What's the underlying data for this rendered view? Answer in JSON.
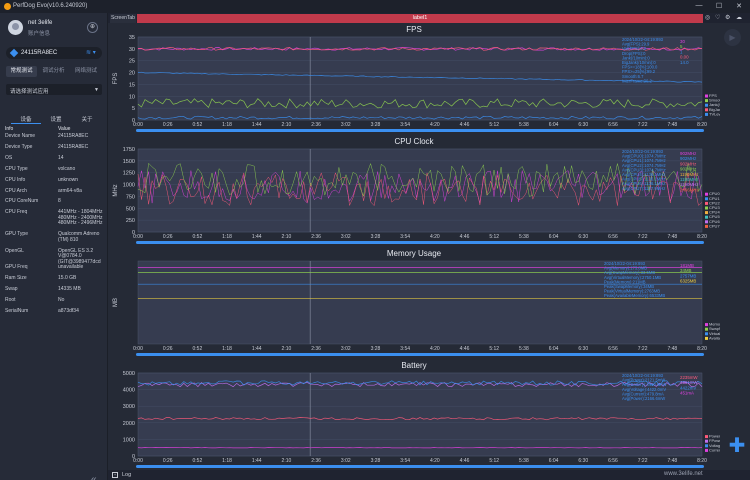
{
  "app": {
    "title": "PerfDog Evo(v10.6.240920)"
  },
  "window": {
    "minimize": "—",
    "maximize": "☐",
    "close": "✕"
  },
  "user": {
    "name": "net 3elife",
    "status": "账户信息"
  },
  "device": {
    "name": "24115RA8EC"
  },
  "mode_tabs": [
    "常规测试",
    "调试分析",
    "网络测试"
  ],
  "app_select": {
    "placeholder": "请选择测试应用"
  },
  "sub_tabs": [
    "设备",
    "设置",
    "关于"
  ],
  "info": {
    "header": {
      "k": "Info",
      "v": "Value"
    },
    "rows": [
      {
        "k": "Device Name",
        "v": "24115RA8EC"
      },
      {
        "k": "Device Type",
        "v": "24115RA8EC"
      },
      {
        "k": "OS",
        "v": "14"
      },
      {
        "k": "CPU Type",
        "v": "volcano"
      },
      {
        "k": "CPU Info",
        "v": "unknown"
      },
      {
        "k": "CPU Arch",
        "v": "arm64-v8a"
      },
      {
        "k": "CPU CoreNum",
        "v": "8"
      },
      {
        "k": "CPU Freq",
        "v": "441MHz - 1804MHz\n480MHz - 2400MHz\n480MHz - 2496MHz"
      },
      {
        "k": "GPU Type",
        "v": "Qualcomm Adreno (TM) 810"
      },
      {
        "k": "OpenGL",
        "v": "OpenGL ES 3.2 V@0784.0 (GIT@3989477dcd"
      },
      {
        "k": "GPU Freq",
        "v": "unavailable"
      },
      {
        "k": "Ram Size",
        "v": "15.0 GB"
      },
      {
        "k": "Swap",
        "v": "14335 MB"
      },
      {
        "k": "Root",
        "v": "No"
      },
      {
        "k": "SerialNum",
        "v": "a873df34"
      }
    ]
  },
  "tabs": {
    "first": "ScreenTab",
    "active": "label1"
  },
  "bottom": {
    "log": "Log",
    "watermark": "www.3elife.net"
  },
  "colors": {
    "accent": "#3b8ff0",
    "panel": "#363c50",
    "active_tab": "#c13a4b"
  },
  "chart_data": [
    {
      "type": "line",
      "title": "FPS",
      "ylabel": "FPS",
      "ylim": [
        0,
        35
      ],
      "yticks": [
        0,
        5,
        10,
        15,
        20,
        25,
        30,
        35
      ],
      "xticks": [
        "0:00",
        "0:26",
        "0:52",
        "1:18",
        "1:44",
        "2:10",
        "2:36",
        "3:02",
        "3:28",
        "3:54",
        "4:20",
        "4:46",
        "5:12",
        "5:38",
        "6:04",
        "6:30",
        "6:56",
        "7:22",
        "7:48",
        "8:20"
      ],
      "series": [
        {
          "name": "FPS",
          "color": "#e040e0",
          "approx": 30
        },
        {
          "name": "Smooth",
          "color": "#8fd14f",
          "approx": 5
        },
        {
          "name": "Jank",
          "color": "#3b8ff0",
          "approx": 1
        },
        {
          "name": "InterFrame",
          "color": "#ff5a7a",
          "approx": 30
        },
        {
          "name": "TVLevelFPS",
          "color": "#3b8ff0",
          "approx": 17
        }
      ],
      "legend": [
        "FPS",
        "Smooth",
        "Jank(/10min)",
        "BigJank(/10min)",
        "TVLevelFPS"
      ],
      "legend_values": [
        "30",
        "5",
        "1",
        "0.00",
        "14.0"
      ],
      "legend_colors": [
        "#e040e0",
        "#8fd14f",
        "#3b8ff0",
        "#ff5a7a",
        "#3b8ff0"
      ],
      "summary": [
        "2024/10/22-04:19:893",
        "Avg(FPS):29.9",
        "Var(FPS):0.2",
        "Drop(FPS):0",
        "Jank(/10min):0",
        "BigJank(/10min):0",
        "FPS>=18[%]:100.0",
        "FPS>=25[%]:99.2",
        "Smooth:6.7",
        "InterFrame:30.2"
      ]
    },
    {
      "type": "line",
      "title": "CPU Clock",
      "ylabel": "MHz",
      "ylim": [
        0,
        1750
      ],
      "yticks": [
        0,
        250,
        500,
        750,
        1000,
        1250,
        1500,
        1750
      ],
      "xticks": [
        "0:00",
        "0:26",
        "0:52",
        "1:18",
        "1:44",
        "2:10",
        "2:36",
        "3:02",
        "3:28",
        "3:54",
        "4:20",
        "4:46",
        "5:12",
        "5:38",
        "6:04",
        "6:30",
        "6:56",
        "7:22",
        "7:48",
        "8:20"
      ],
      "series": [
        {
          "name": "CPU0",
          "color": "#e040e0",
          "approx": 950
        },
        {
          "name": "CPU1",
          "color": "#ff5a7a",
          "approx": 900
        },
        {
          "name": "CPU2",
          "color": "#8fd14f",
          "approx": 1100
        }
      ],
      "legend": [
        "CPU0",
        "CPU1",
        "CPU2",
        "CPU3",
        "CPU4",
        "CPU5",
        "CPU6",
        "CPU7"
      ],
      "legend_values": [
        "902MHz",
        "902MHz",
        "902MHz",
        "902MHz",
        "1190MHz",
        "1190MHz",
        "1190MHz",
        "2496MHz"
      ],
      "legend_colors": [
        "#e040e0",
        "#3b8ff0",
        "#ff5a7a",
        "#8fd14f",
        "#f0b040",
        "#40c0c0",
        "#c070f0",
        "#f06040"
      ],
      "summary": [
        "2024/10/22-04:19:893",
        "Avg(CPU0):1074.7MHz",
        "Avg(CPU1):1074.7MHz",
        "Avg(CPU2):1074.7MHz",
        "Avg(CPU3):1074.7MHz",
        "Avg(CPU4):1136.1MHz",
        "Avg(CPU5):1136.1MHz",
        "Avg(CPU6):1136.1MHz",
        "Avg(CPU7):1187.9MHz"
      ]
    },
    {
      "type": "line",
      "title": "Memory Usage",
      "ylabel": "MB",
      "xticks": [
        "0:00",
        "0:26",
        "0:52",
        "1:18",
        "1:44",
        "2:10",
        "2:36",
        "3:02",
        "3:28",
        "3:54",
        "4:20",
        "4:46",
        "5:12",
        "5:38",
        "6:04",
        "6:30",
        "6:56",
        "7:22",
        "7:48",
        "8:20"
      ],
      "series": [
        {
          "name": "Memory",
          "color": "#e040e0",
          "frac": 0.92
        },
        {
          "name": "SwapMemory",
          "color": "#8fd14f",
          "frac": 0.86
        },
        {
          "name": "VirtualMemory",
          "color": "#3b8ff0",
          "frac": 0.72
        },
        {
          "name": "AvailableMemory",
          "color": "#f0d040",
          "frac": 0.55
        }
      ],
      "legend": [
        "Memory",
        "SwapMemory",
        "VirtualMemory",
        "AvailableMemory"
      ],
      "legend_values": [
        "181MB",
        "34MB",
        "2757MB",
        "6325MB"
      ],
      "legend_colors": [
        "#e040e0",
        "#8fd14f",
        "#3b8ff0",
        "#f0d040"
      ],
      "summary": [
        "2024/10/22-04:19:893",
        "Avg(Memory):173.8MB",
        "Avg(SwapMemory):33.5MB",
        "Avg(VirtualMemory):2750.1MB",
        "Peak(Memory):211MB",
        "Peak(SwapMemory):34MB",
        "Peak(VirtualMemory):2763MB",
        "Peak(AvailableMemory):6533MB"
      ]
    },
    {
      "type": "line",
      "title": "Battery",
      "ylim": [
        0,
        5000
      ],
      "yticks": [
        0,
        1000,
        2000,
        3000,
        4000,
        5000
      ],
      "xticks": [
        "0:00",
        "0:26",
        "0:52",
        "1:18",
        "1:44",
        "2:10",
        "2:36",
        "3:02",
        "3:28",
        "3:54",
        "4:20",
        "4:46",
        "5:12",
        "5:38",
        "6:04",
        "6:30",
        "6:56",
        "7:22",
        "7:48",
        "8:20"
      ],
      "series": [
        {
          "name": "Power",
          "color": "#ff5a7a",
          "approx": 2250
        },
        {
          "name": "FPower",
          "color": "#c070f0",
          "approx": 4300
        },
        {
          "name": "Voltage",
          "color": "#3b8ff0",
          "approx": 4400
        },
        {
          "name": "Current",
          "color": "#e040e0",
          "approx": 500
        }
      ],
      "legend": [
        "Power",
        "FPower",
        "Voltage",
        "Current"
      ],
      "legend_values": [
        "2235mW",
        "4361mW",
        "4422mV",
        "451mA"
      ],
      "legend_colors": [
        "#ff5a7a",
        "#c070f0",
        "#3b8ff0",
        "#e040e0"
      ],
      "summary": [
        "2024/10/22-04:19:893",
        "Avg(Power):2121.5mW",
        "Avg(Battery):4410.0mW",
        "Avg(Voltage):4422.0mV",
        "Avg(Current):479.8mA",
        "Avg(Power):2166.6mW"
      ]
    }
  ]
}
